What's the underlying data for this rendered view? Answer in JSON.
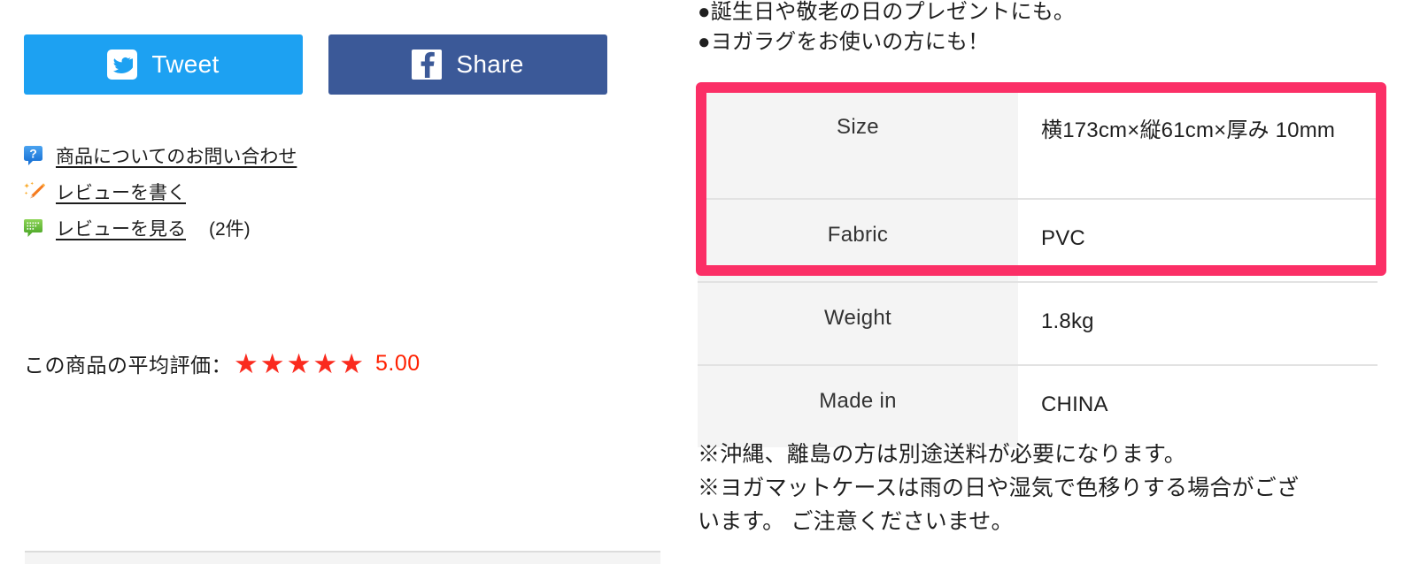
{
  "social": {
    "tweet": {
      "label": "Tweet",
      "icon": "twitter-bird-icon",
      "color": "#1da1f2"
    },
    "share": {
      "label": "Share",
      "icon": "facebook-f-icon",
      "color": "#3b5998"
    }
  },
  "links": [
    {
      "icon": "question-speech-bubble-icon",
      "label": "商品についてのお問い合わせ",
      "count": ""
    },
    {
      "icon": "pencil-sparkle-icon",
      "label": "レビューを書く",
      "count": ""
    },
    {
      "icon": "green-speech-bubble-icon",
      "label": "レビューを見る",
      "count": "(2件)"
    }
  ],
  "rating": {
    "label": "この商品の平均評価：",
    "stars_filled": 5,
    "star_glyph": "★",
    "value": "5.00",
    "star_color": "#fa2a1e",
    "value_color": "#ff2000"
  },
  "bullets": [
    "●誕生日や敬老の日のプレゼントにも。",
    "●ヨガラグをお使いの方にも！"
  ],
  "spec_table": {
    "highlight_color": "#fb2f66",
    "highlighted_rows": [
      0,
      1
    ],
    "rows": [
      {
        "key": "Size",
        "value": "横173cm×縦61cm×厚み 10mm"
      },
      {
        "key": "Fabric",
        "value": "PVC"
      },
      {
        "key": "Weight",
        "value": "1.8kg"
      },
      {
        "key": "Made in",
        "value": "CHINA"
      }
    ]
  },
  "notes": [
    "※沖縄、離島の方は別途送料が必要になります。",
    "※ヨガマットケースは雨の日や湿気で色移りする場合がござ",
    "います。 ご注意くださいませ。"
  ]
}
